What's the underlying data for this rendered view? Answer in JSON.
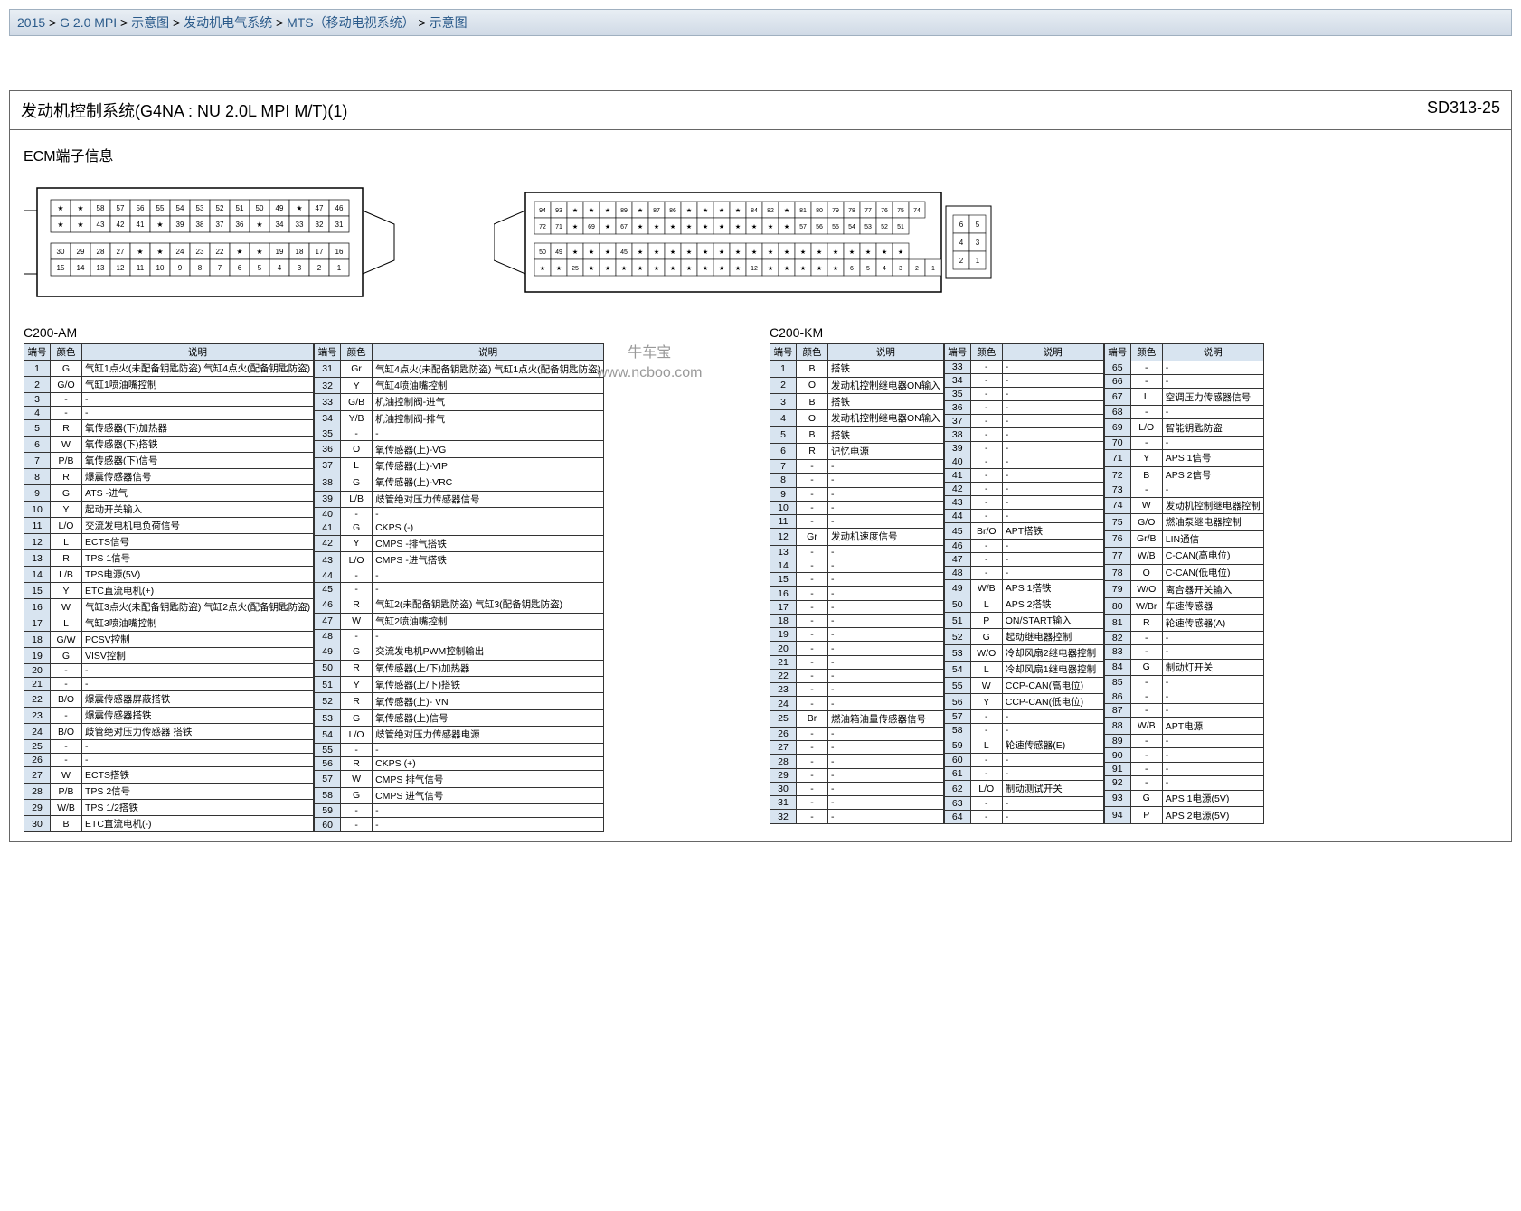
{
  "breadcrumb": [
    "2015",
    "G 2.0 MPI",
    "示意图",
    "发动机电气系统",
    "MTS（移动电视系统）",
    "示意图"
  ],
  "title": "发动机控制系统(G4NA : NU 2.0L MPI M/T)(1)",
  "code": "SD313-25",
  "section": "ECM端子信息",
  "watermark_top": "牛车宝",
  "watermark_bottom": "www.ncboo.com",
  "labels": {
    "am": "C200-AM",
    "km": "C200-KM"
  },
  "headers": {
    "pin": "端号",
    "color": "颜色",
    "desc": "说明"
  },
  "am_left": [
    {
      "n": "1",
      "c": "G",
      "d": "气缸1点火(未配备钥匙防盗) 气缸4点火(配备钥匙防盗)"
    },
    {
      "n": "2",
      "c": "G/O",
      "d": "气缸1喷油嘴控制"
    },
    {
      "n": "3",
      "c": "-",
      "d": "-"
    },
    {
      "n": "4",
      "c": "-",
      "d": "-"
    },
    {
      "n": "5",
      "c": "R",
      "d": "氧传感器(下)加热器"
    },
    {
      "n": "6",
      "c": "W",
      "d": "氧传感器(下)搭铁"
    },
    {
      "n": "7",
      "c": "P/B",
      "d": "氧传感器(下)信号"
    },
    {
      "n": "8",
      "c": "R",
      "d": "爆震传感器信号"
    },
    {
      "n": "9",
      "c": "G",
      "d": "ATS -进气"
    },
    {
      "n": "10",
      "c": "Y",
      "d": "起动开关输入"
    },
    {
      "n": "11",
      "c": "L/O",
      "d": "交流发电机电负荷信号"
    },
    {
      "n": "12",
      "c": "L",
      "d": "ECTS信号"
    },
    {
      "n": "13",
      "c": "R",
      "d": "TPS 1信号"
    },
    {
      "n": "14",
      "c": "L/B",
      "d": "TPS电源(5V)"
    },
    {
      "n": "15",
      "c": "Y",
      "d": "ETC直流电机(+)"
    },
    {
      "n": "16",
      "c": "W",
      "d": "气缸3点火(未配备钥匙防盗) 气缸2点火(配备钥匙防盗)"
    },
    {
      "n": "17",
      "c": "L",
      "d": "气缸3喷油嘴控制"
    },
    {
      "n": "18",
      "c": "G/W",
      "d": "PCSV控制"
    },
    {
      "n": "19",
      "c": "G",
      "d": "VISV控制"
    },
    {
      "n": "20",
      "c": "-",
      "d": "-"
    },
    {
      "n": "21",
      "c": "-",
      "d": "-"
    },
    {
      "n": "22",
      "c": "B/O",
      "d": "爆震传感器屏蔽搭铁"
    },
    {
      "n": "23",
      "c": "-",
      "d": "爆震传感器搭铁"
    },
    {
      "n": "24",
      "c": "B/O",
      "d": "歧管绝对压力传感器 搭铁"
    },
    {
      "n": "25",
      "c": "-",
      "d": "-"
    },
    {
      "n": "26",
      "c": "-",
      "d": "-"
    },
    {
      "n": "27",
      "c": "W",
      "d": "ECTS搭铁"
    },
    {
      "n": "28",
      "c": "P/B",
      "d": "TPS 2信号"
    },
    {
      "n": "29",
      "c": "W/B",
      "d": "TPS 1/2搭铁"
    },
    {
      "n": "30",
      "c": "B",
      "d": "ETC直流电机(-)"
    }
  ],
  "am_right": [
    {
      "n": "31",
      "c": "Gr",
      "d": "气缸4点火(未配备钥匙防盗) 气缸1点火(配备钥匙防盗)"
    },
    {
      "n": "32",
      "c": "Y",
      "d": "气缸4喷油嘴控制"
    },
    {
      "n": "33",
      "c": "G/B",
      "d": "机油控制阀-进气"
    },
    {
      "n": "34",
      "c": "Y/B",
      "d": "机油控制阀-排气"
    },
    {
      "n": "35",
      "c": "-",
      "d": "-"
    },
    {
      "n": "36",
      "c": "O",
      "d": "氧传感器(上)-VG"
    },
    {
      "n": "37",
      "c": "L",
      "d": "氧传感器(上)-VIP"
    },
    {
      "n": "38",
      "c": "G",
      "d": "氧传感器(上)-VRC"
    },
    {
      "n": "39",
      "c": "L/B",
      "d": "歧管绝对压力传感器信号"
    },
    {
      "n": "40",
      "c": "-",
      "d": "-"
    },
    {
      "n": "41",
      "c": "G",
      "d": "CKPS (-)"
    },
    {
      "n": "42",
      "c": "Y",
      "d": "CMPS -排气搭铁"
    },
    {
      "n": "43",
      "c": "L/O",
      "d": "CMPS -进气搭铁"
    },
    {
      "n": "44",
      "c": "-",
      "d": "-"
    },
    {
      "n": "45",
      "c": "-",
      "d": "-"
    },
    {
      "n": "46",
      "c": "R",
      "d": "气缸2(未配备钥匙防盗) 气缸3(配备钥匙防盗)"
    },
    {
      "n": "47",
      "c": "W",
      "d": "气缸2喷油嘴控制"
    },
    {
      "n": "48",
      "c": "-",
      "d": "-"
    },
    {
      "n": "49",
      "c": "G",
      "d": "交流发电机PWM控制输出"
    },
    {
      "n": "50",
      "c": "R",
      "d": "氧传感器(上/下)加热器"
    },
    {
      "n": "51",
      "c": "Y",
      "d": "氧传感器(上/下)搭铁"
    },
    {
      "n": "52",
      "c": "R",
      "d": "氧传感器(上)- VN"
    },
    {
      "n": "53",
      "c": "G",
      "d": "氧传感器(上)信号"
    },
    {
      "n": "54",
      "c": "L/O",
      "d": "歧管绝对压力传感器电源"
    },
    {
      "n": "55",
      "c": "-",
      "d": "-"
    },
    {
      "n": "56",
      "c": "R",
      "d": "CKPS (+)"
    },
    {
      "n": "57",
      "c": "W",
      "d": "CMPS 排气信号"
    },
    {
      "n": "58",
      "c": "G",
      "d": "CMPS 进气信号"
    },
    {
      "n": "59",
      "c": "-",
      "d": "-"
    },
    {
      "n": "60",
      "c": "-",
      "d": "-"
    }
  ],
  "km_a": [
    {
      "n": "1",
      "c": "B",
      "d": "搭铁"
    },
    {
      "n": "2",
      "c": "O",
      "d": "发动机控制继电器ON输入"
    },
    {
      "n": "3",
      "c": "B",
      "d": "搭铁"
    },
    {
      "n": "4",
      "c": "O",
      "d": "发动机控制继电器ON输入"
    },
    {
      "n": "5",
      "c": "B",
      "d": "搭铁"
    },
    {
      "n": "6",
      "c": "R",
      "d": "记忆电源"
    },
    {
      "n": "7",
      "c": "-",
      "d": "-"
    },
    {
      "n": "8",
      "c": "-",
      "d": "-"
    },
    {
      "n": "9",
      "c": "-",
      "d": "-"
    },
    {
      "n": "10",
      "c": "-",
      "d": "-"
    },
    {
      "n": "11",
      "c": "-",
      "d": "-"
    },
    {
      "n": "12",
      "c": "Gr",
      "d": "发动机速度信号"
    },
    {
      "n": "13",
      "c": "-",
      "d": "-"
    },
    {
      "n": "14",
      "c": "-",
      "d": "-"
    },
    {
      "n": "15",
      "c": "-",
      "d": "-"
    },
    {
      "n": "16",
      "c": "-",
      "d": "-"
    },
    {
      "n": "17",
      "c": "-",
      "d": "-"
    },
    {
      "n": "18",
      "c": "-",
      "d": "-"
    },
    {
      "n": "19",
      "c": "-",
      "d": "-"
    },
    {
      "n": "20",
      "c": "-",
      "d": "-"
    },
    {
      "n": "21",
      "c": "-",
      "d": "-"
    },
    {
      "n": "22",
      "c": "-",
      "d": "-"
    },
    {
      "n": "23",
      "c": "-",
      "d": "-"
    },
    {
      "n": "24",
      "c": "-",
      "d": "-"
    },
    {
      "n": "25",
      "c": "Br",
      "d": "燃油箱油量传感器信号"
    },
    {
      "n": "26",
      "c": "-",
      "d": "-"
    },
    {
      "n": "27",
      "c": "-",
      "d": "-"
    },
    {
      "n": "28",
      "c": "-",
      "d": "-"
    },
    {
      "n": "29",
      "c": "-",
      "d": "-"
    },
    {
      "n": "30",
      "c": "-",
      "d": "-"
    },
    {
      "n": "31",
      "c": "-",
      "d": "-"
    },
    {
      "n": "32",
      "c": "-",
      "d": "-"
    }
  ],
  "km_b": [
    {
      "n": "33",
      "c": "-",
      "d": "-"
    },
    {
      "n": "34",
      "c": "-",
      "d": "-"
    },
    {
      "n": "35",
      "c": "-",
      "d": "-"
    },
    {
      "n": "36",
      "c": "-",
      "d": "-"
    },
    {
      "n": "37",
      "c": "-",
      "d": "-"
    },
    {
      "n": "38",
      "c": "-",
      "d": "-"
    },
    {
      "n": "39",
      "c": "-",
      "d": "-"
    },
    {
      "n": "40",
      "c": "-",
      "d": "-"
    },
    {
      "n": "41",
      "c": "-",
      "d": "-"
    },
    {
      "n": "42",
      "c": "-",
      "d": "-"
    },
    {
      "n": "43",
      "c": "-",
      "d": "-"
    },
    {
      "n": "44",
      "c": "-",
      "d": "-"
    },
    {
      "n": "45",
      "c": "Br/O",
      "d": "APT搭铁"
    },
    {
      "n": "46",
      "c": "-",
      "d": "-"
    },
    {
      "n": "47",
      "c": "-",
      "d": "-"
    },
    {
      "n": "48",
      "c": "-",
      "d": "-"
    },
    {
      "n": "49",
      "c": "W/B",
      "d": "APS 1搭铁"
    },
    {
      "n": "50",
      "c": "L",
      "d": "APS 2搭铁"
    },
    {
      "n": "51",
      "c": "P",
      "d": "ON/START输入"
    },
    {
      "n": "52",
      "c": "G",
      "d": "起动继电器控制"
    },
    {
      "n": "53",
      "c": "W/O",
      "d": "冷却风扇2继电器控制"
    },
    {
      "n": "54",
      "c": "L",
      "d": "冷却风扇1继电器控制"
    },
    {
      "n": "55",
      "c": "W",
      "d": "CCP-CAN(高电位)"
    },
    {
      "n": "56",
      "c": "Y",
      "d": "CCP-CAN(低电位)"
    },
    {
      "n": "57",
      "c": "-",
      "d": "-"
    },
    {
      "n": "58",
      "c": "-",
      "d": "-"
    },
    {
      "n": "59",
      "c": "L",
      "d": "轮速传感器(E)"
    },
    {
      "n": "60",
      "c": "-",
      "d": "-"
    },
    {
      "n": "61",
      "c": "-",
      "d": "-"
    },
    {
      "n": "62",
      "c": "L/O",
      "d": "制动测试开关"
    },
    {
      "n": "63",
      "c": "-",
      "d": "-"
    },
    {
      "n": "64",
      "c": "-",
      "d": "-"
    }
  ],
  "km_c": [
    {
      "n": "65",
      "c": "-",
      "d": "-"
    },
    {
      "n": "66",
      "c": "-",
      "d": "-"
    },
    {
      "n": "67",
      "c": "L",
      "d": "空调压力传感器信号"
    },
    {
      "n": "68",
      "c": "-",
      "d": "-"
    },
    {
      "n": "69",
      "c": "L/O",
      "d": "智能钥匙防盗"
    },
    {
      "n": "70",
      "c": "-",
      "d": "-"
    },
    {
      "n": "71",
      "c": "Y",
      "d": "APS 1信号"
    },
    {
      "n": "72",
      "c": "B",
      "d": "APS 2信号"
    },
    {
      "n": "73",
      "c": "-",
      "d": "-"
    },
    {
      "n": "74",
      "c": "W",
      "d": "发动机控制继电器控制"
    },
    {
      "n": "75",
      "c": "G/O",
      "d": "燃油泵继电器控制"
    },
    {
      "n": "76",
      "c": "Gr/B",
      "d": "LIN通信"
    },
    {
      "n": "77",
      "c": "W/B",
      "d": "C-CAN(高电位)"
    },
    {
      "n": "78",
      "c": "O",
      "d": "C-CAN(低电位)"
    },
    {
      "n": "79",
      "c": "W/O",
      "d": "离合器开关输入"
    },
    {
      "n": "80",
      "c": "W/Br",
      "d": "车速传感器"
    },
    {
      "n": "81",
      "c": "R",
      "d": "轮速传感器(A)"
    },
    {
      "n": "82",
      "c": "-",
      "d": "-"
    },
    {
      "n": "83",
      "c": "-",
      "d": "-"
    },
    {
      "n": "84",
      "c": "G",
      "d": "制动灯开关"
    },
    {
      "n": "85",
      "c": "-",
      "d": "-"
    },
    {
      "n": "86",
      "c": "-",
      "d": "-"
    },
    {
      "n": "87",
      "c": "-",
      "d": "-"
    },
    {
      "n": "88",
      "c": "W/B",
      "d": "APT电源"
    },
    {
      "n": "89",
      "c": "-",
      "d": "-"
    },
    {
      "n": "90",
      "c": "-",
      "d": "-"
    },
    {
      "n": "91",
      "c": "-",
      "d": "-"
    },
    {
      "n": "92",
      "c": "-",
      "d": "-"
    },
    {
      "n": "93",
      "c": "G",
      "d": "APS 1电源(5V)"
    },
    {
      "n": "94",
      "c": "P",
      "d": "APS 2电源(5V)"
    }
  ],
  "conn_am_rows": [
    [
      "★",
      "★",
      "58",
      "57",
      "56",
      "55",
      "54",
      "53",
      "52",
      "51",
      "50",
      "49",
      "★",
      "47",
      "46"
    ],
    [
      "★",
      "★",
      "43",
      "42",
      "41",
      "★",
      "39",
      "38",
      "37",
      "36",
      "★",
      "34",
      "33",
      "32",
      "31"
    ],
    [
      "30",
      "29",
      "28",
      "27",
      "★",
      "★",
      "24",
      "23",
      "22",
      "★",
      "★",
      "19",
      "18",
      "17",
      "16"
    ],
    [
      "15",
      "14",
      "13",
      "12",
      "11",
      "10",
      "9",
      "8",
      "7",
      "6",
      "5",
      "4",
      "3",
      "2",
      "1"
    ]
  ],
  "conn_km_rows": [
    [
      "94",
      "93",
      "★",
      "★",
      "★",
      "89",
      "★",
      "87",
      "86",
      "★",
      "★",
      "★",
      "★",
      "84",
      "82",
      "★",
      "81",
      "80",
      "79",
      "78",
      "77",
      "76",
      "75",
      "74"
    ],
    [
      "72",
      "71",
      "★",
      "69",
      "★",
      "67",
      "★",
      "★",
      "★",
      "★",
      "★",
      "★",
      "★",
      "★",
      "★",
      "★",
      "57",
      "56",
      "55",
      "54",
      "53",
      "52",
      "51"
    ],
    [
      "50",
      "49",
      "★",
      "★",
      "★",
      "45",
      "★",
      "★",
      "★",
      "★",
      "★",
      "★",
      "★",
      "★",
      "★",
      "★",
      "★",
      "★",
      "★",
      "★",
      "★",
      "★",
      "★"
    ],
    [
      "★",
      "★",
      "25",
      "★",
      "★",
      "★",
      "★",
      "★",
      "★",
      "★",
      "★",
      "★",
      "★",
      "12",
      "★",
      "★",
      "★",
      "★",
      "★",
      "6",
      "5",
      "4",
      "3",
      "2",
      "1"
    ]
  ],
  "conn_km_side": [
    [
      "6",
      "5"
    ],
    [
      "4",
      "3"
    ],
    [
      "2",
      "1"
    ]
  ]
}
